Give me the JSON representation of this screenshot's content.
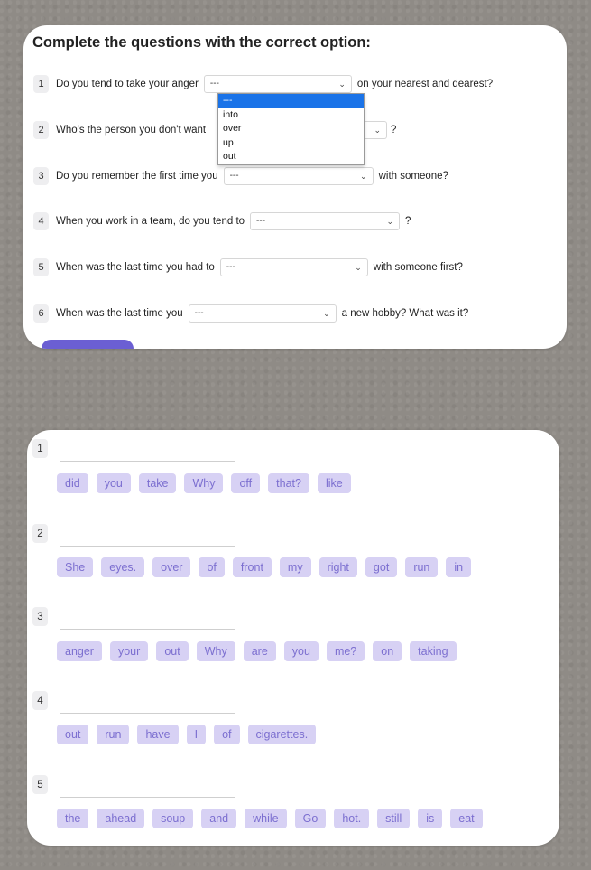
{
  "exercise1": {
    "title": "Complete the questions with the correct option:",
    "questions": [
      {
        "num": "1",
        "before": "Do you tend to take your anger",
        "select": "---",
        "after": "on your nearest and dearest?"
      },
      {
        "num": "2",
        "before": "Who's the person you don't want",
        "select": "",
        "after": "?"
      },
      {
        "num": "3",
        "before": "Do you remember the first time you",
        "select": "---",
        "after": "with someone?"
      },
      {
        "num": "4",
        "before": "When you work in a team, do you tend to",
        "select": "---",
        "after": "?"
      },
      {
        "num": "5",
        "before": "When was the last time you had to",
        "select": "---",
        "after": "with someone first?"
      },
      {
        "num": "6",
        "before": "When was the last time you",
        "select": "---",
        "after": "a new hobby? What was it?"
      }
    ],
    "dropdown_options": [
      "---",
      "into",
      "over",
      "up",
      "out"
    ]
  },
  "exercise2": {
    "rows": [
      {
        "num": "1",
        "words": [
          "did",
          "you",
          "take",
          "Why",
          "off",
          "that?",
          "like"
        ]
      },
      {
        "num": "2",
        "words": [
          "She",
          "eyes.",
          "over",
          "of",
          "front",
          "my",
          "right",
          "got",
          "run",
          "in"
        ]
      },
      {
        "num": "3",
        "words": [
          "anger",
          "your",
          "out",
          "Why",
          "are",
          "you",
          "me?",
          "on",
          "taking"
        ]
      },
      {
        "num": "4",
        "words": [
          "out",
          "run",
          "have",
          "I",
          "of",
          "cigarettes."
        ]
      },
      {
        "num": "5",
        "words": [
          "the",
          "ahead",
          "soup",
          "and",
          "while",
          "Go",
          "hot.",
          "still",
          "is",
          "eat"
        ]
      }
    ]
  },
  "colors": {
    "background": "#8f8b86",
    "chip_bg": "#d7d1f4",
    "chip_text": "#7c6fd0",
    "dropdown_highlight": "#1a73e8",
    "button_purple": "#6b5fd3"
  }
}
